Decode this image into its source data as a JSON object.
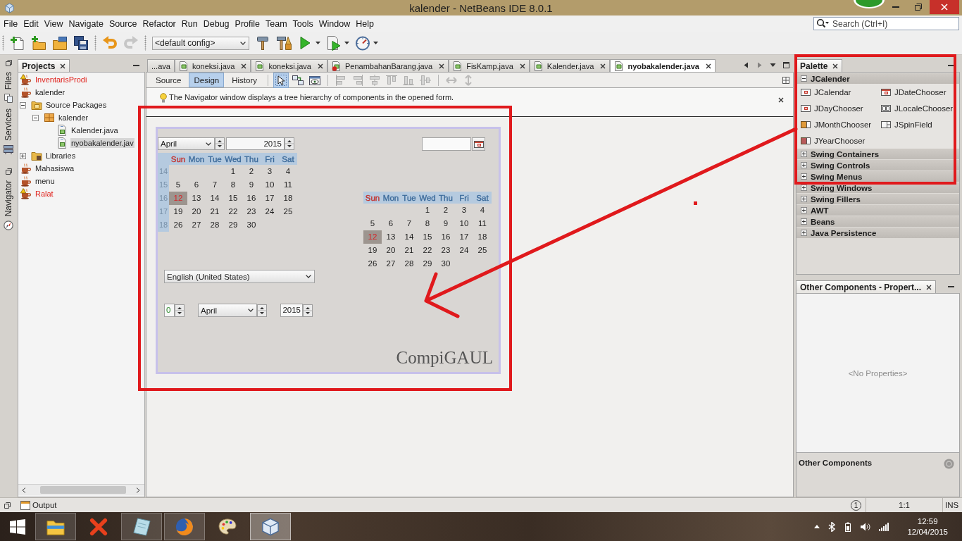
{
  "window": {
    "title": "kalender - NetBeans IDE 8.0.1"
  },
  "menu": [
    "File",
    "Edit",
    "View",
    "Navigate",
    "Source",
    "Refactor",
    "Run",
    "Debug",
    "Profile",
    "Team",
    "Tools",
    "Window",
    "Help"
  ],
  "search": {
    "placeholder": "Search (Ctrl+I)"
  },
  "toolbar": [
    {
      "kind": "separator"
    },
    {
      "kind": "new-file",
      "disabled": false
    },
    {
      "kind": "new-project",
      "disabled": false
    },
    {
      "kind": "open-project",
      "disabled": false
    },
    {
      "kind": "save-all",
      "disabled": false
    },
    {
      "kind": "separator"
    },
    {
      "kind": "undo",
      "disabled": false
    },
    {
      "kind": "redo",
      "disabled": true
    },
    {
      "kind": "separator"
    },
    {
      "kind": "config",
      "value": "<default config>"
    },
    {
      "kind": "build",
      "disabled": false
    },
    {
      "kind": "clean-build",
      "disabled": false
    },
    {
      "kind": "run",
      "disabled": false
    },
    {
      "kind": "debug",
      "disabled": false
    },
    {
      "kind": "profile",
      "disabled": false
    }
  ],
  "side_panels": [
    {
      "tabs": [
        {
          "label": "Files",
          "kind": "files"
        },
        {
          "label": "Services",
          "kind": "services"
        }
      ]
    },
    {
      "tabs": [
        {
          "label": "Navigator",
          "kind": "navigator"
        }
      ]
    }
  ],
  "projects": {
    "title": "Projects",
    "tree": [
      {
        "label": "InventarisProdi",
        "kind": "project",
        "error": true,
        "selected": false
      },
      {
        "label": "kalender",
        "kind": "project",
        "error": false,
        "selected": false,
        "children": [
          {
            "label": "Source Packages",
            "kind": "sources",
            "expanded": true,
            "selected": false,
            "children": [
              {
                "label": "kalender",
                "kind": "package",
                "expanded": true,
                "selected": false,
                "children": [
                  {
                    "label": "Kalender.java",
                    "kind": "form",
                    "selected": false
                  },
                  {
                    "label": "nyobakalender.jav",
                    "kind": "form",
                    "selected": true
                  }
                ]
              }
            ]
          },
          {
            "label": "Libraries",
            "kind": "libraries",
            "expanded": false,
            "selected": false
          }
        ]
      },
      {
        "label": "Mahasiswa",
        "kind": "project",
        "error": false,
        "selected": false
      },
      {
        "label": "menu",
        "kind": "project",
        "error": false,
        "selected": false
      },
      {
        "label": "Ralat",
        "kind": "project",
        "error": true,
        "selected": false
      }
    ]
  },
  "editor": {
    "tabs": [
      {
        "label": "...ava",
        "kind": "clipped",
        "selected": false
      },
      {
        "label": "koneksi.java",
        "kind": "file",
        "error": false,
        "selected": false
      },
      {
        "label": "koneksi.java",
        "kind": "file",
        "error": false,
        "selected": false
      },
      {
        "label": "PenambahanBarang.java",
        "kind": "file",
        "error": true,
        "selected": false
      },
      {
        "label": "FisKamp.java",
        "kind": "file",
        "error": false,
        "selected": false
      },
      {
        "label": "Kalender.java",
        "kind": "file",
        "error": false,
        "selected": false
      },
      {
        "label": "nyobakalender.java",
        "kind": "file",
        "error": false,
        "selected": true
      }
    ],
    "tab_nav": [
      {
        "kind": "previous",
        "disabled": false
      },
      {
        "kind": "next",
        "disabled": true
      },
      {
        "kind": "list",
        "disabled": false
      },
      {
        "kind": "maximize",
        "disabled": false
      }
    ],
    "views": [
      {
        "label": "Source",
        "selected": false
      },
      {
        "label": "Design",
        "selected": true
      },
      {
        "label": "History",
        "selected": false
      }
    ],
    "design_tools": [
      {
        "kind": "selection",
        "selected": true
      },
      {
        "kind": "connection",
        "selected": false
      },
      {
        "kind": "preview",
        "selected": false
      },
      {
        "kind": "separator"
      },
      {
        "kind": "align-left",
        "disabled": true
      },
      {
        "kind": "align-right",
        "disabled": true
      },
      {
        "kind": "align-center",
        "disabled": true
      },
      {
        "kind": "align-top",
        "disabled": true
      },
      {
        "kind": "align-bottom",
        "disabled": true
      },
      {
        "kind": "align-middle",
        "disabled": true
      },
      {
        "kind": "separator"
      },
      {
        "kind": "resize-horizontal",
        "disabled": true
      },
      {
        "kind": "resize-vertical",
        "disabled": true
      }
    ],
    "hint": "The Navigator window displays a tree hierarchy of components in the opened form.",
    "form": {
      "calendar": {
        "month": "April",
        "year": "2015",
        "weekdays": [
          {
            "label": "Sun",
            "color": "#c4302b"
          },
          {
            "label": "Mon",
            "color": "#3b6a9a"
          },
          {
            "label": "Tue",
            "color": "#3b6a9a"
          },
          {
            "label": "Wed",
            "color": "#3b6a9a"
          },
          {
            "label": "Thu",
            "color": "#3b6a9a"
          },
          {
            "label": "Fri",
            "color": "#3b6a9a"
          },
          {
            "label": "Sat",
            "color": "#3b6a9a"
          }
        ],
        "weeks": [
          {
            "number": "14",
            "days": [
              {
                "label": "1",
                "selected": false
              },
              {
                "label": "2",
                "selected": false
              },
              {
                "label": "3",
                "selected": false
              },
              {
                "label": "4",
                "selected": false
              }
            ]
          },
          {
            "number": "15",
            "days": [
              {
                "label": "5",
                "selected": false
              },
              {
                "label": "6",
                "selected": false
              },
              {
                "label": "7",
                "selected": false
              },
              {
                "label": "8",
                "selected": false
              },
              {
                "label": "9",
                "selected": false
              },
              {
                "label": "10",
                "selected": false
              },
              {
                "label": "11",
                "selected": false
              }
            ]
          },
          {
            "number": "16",
            "days": [
              {
                "label": "12",
                "selected": true
              },
              {
                "label": "13",
                "selected": false
              },
              {
                "label": "14",
                "selected": false
              },
              {
                "label": "15",
                "selected": false
              },
              {
                "label": "16",
                "selected": false
              },
              {
                "label": "17",
                "selected": false
              },
              {
                "label": "18",
                "selected": false
              }
            ]
          },
          {
            "number": "17",
            "days": [
              {
                "label": "19",
                "selected": false
              },
              {
                "label": "20",
                "selected": false
              },
              {
                "label": "21",
                "selected": false
              },
              {
                "label": "22",
                "selected": false
              },
              {
                "label": "23",
                "selected": false
              },
              {
                "label": "24",
                "selected": false
              },
              {
                "label": "25",
                "selected": false
              }
            ]
          },
          {
            "number": "18",
            "days": [
              {
                "label": "26",
                "selected": false
              },
              {
                "label": "27",
                "selected": false
              },
              {
                "label": "28",
                "selected": false
              },
              {
                "label": "29",
                "selected": false
              },
              {
                "label": "30",
                "selected": false
              }
            ]
          }
        ]
      },
      "day_chooser": {
        "weekdays": [
          {
            "label": "Sun",
            "color": "#c4302b"
          },
          {
            "label": "Mon",
            "color": "#3b6a9a"
          },
          {
            "label": "Tue",
            "color": "#3b6a9a"
          },
          {
            "label": "Wed",
            "color": "#3b6a9a"
          },
          {
            "label": "Thu",
            "color": "#3b6a9a"
          },
          {
            "label": "Fri",
            "color": "#3b6a9a"
          },
          {
            "label": "Sat",
            "color": "#3b6a9a"
          }
        ],
        "weeks": [
          {
            "days": [
              {
                "label": "1",
                "selected": false
              },
              {
                "label": "2",
                "selected": false
              },
              {
                "label": "3",
                "selected": false
              },
              {
                "label": "4",
                "selected": false
              }
            ]
          },
          {
            "days": [
              {
                "label": "5",
                "selected": false
              },
              {
                "label": "6",
                "selected": false
              },
              {
                "label": "7",
                "selected": false
              },
              {
                "label": "8",
                "selected": false
              },
              {
                "label": "9",
                "selected": false
              },
              {
                "label": "10",
                "selected": false
              },
              {
                "label": "11",
                "selected": false
              }
            ]
          },
          {
            "days": [
              {
                "label": "12",
                "selected": true
              },
              {
                "label": "13",
                "selected": false
              },
              {
                "label": "14",
                "selected": false
              },
              {
                "label": "15",
                "selected": false
              },
              {
                "label": "16",
                "selected": false
              },
              {
                "label": "17",
                "selected": false
              },
              {
                "label": "18",
                "selected": false
              }
            ]
          },
          {
            "days": [
              {
                "label": "19",
                "selected": false
              },
              {
                "label": "20",
                "selected": false
              },
              {
                "label": "21",
                "selected": false
              },
              {
                "label": "22",
                "selected": false
              },
              {
                "label": "23",
                "selected": false
              },
              {
                "label": "24",
                "selected": false
              },
              {
                "label": "25",
                "selected": false
              }
            ]
          },
          {
            "days": [
              {
                "label": "26",
                "selected": false
              },
              {
                "label": "27",
                "selected": false
              },
              {
                "label": "28",
                "selected": false
              },
              {
                "label": "29",
                "selected": false
              },
              {
                "label": "30",
                "selected": false
              }
            ]
          }
        ]
      },
      "locale_chooser": "English (United States)",
      "spin_field": {
        "value": "0",
        "valid": true
      },
      "month_chooser": "April",
      "year_chooser": "2015",
      "label": "CompiGAUL"
    }
  },
  "palette": {
    "title": "Palette",
    "categories": [
      {
        "label": "JCalender",
        "expanded": true,
        "items": [
          {
            "label": "JCalendar",
            "kind": "calendar"
          },
          {
            "label": "JDateChooser",
            "kind": "date"
          },
          {
            "label": "JDayChooser",
            "kind": "calendar"
          },
          {
            "label": "JLocaleChooser",
            "kind": "combo"
          },
          {
            "label": "JMonthChooser",
            "kind": "month"
          },
          {
            "label": "JSpinField",
            "kind": "spinner"
          },
          {
            "label": "JYearChooser",
            "kind": "year"
          }
        ]
      },
      {
        "label": "Swing Containers",
        "expanded": false
      },
      {
        "label": "Swing Controls",
        "expanded": false
      },
      {
        "label": "Swing Menus",
        "expanded": false
      },
      {
        "label": "Swing Windows",
        "expanded": false
      },
      {
        "label": "Swing Fillers",
        "expanded": false
      },
      {
        "label": "AWT",
        "expanded": false
      },
      {
        "label": "Beans",
        "expanded": false
      },
      {
        "label": "Java Persistence",
        "expanded": false
      }
    ]
  },
  "properties": {
    "title": "Other Components - Propert...",
    "empty": "<No Properties>",
    "footer": "Other Components"
  },
  "status_bar": {
    "output": "Output",
    "notifications": "1",
    "position": "1:1",
    "mode": "INS"
  },
  "taskbar": {
    "apps": [
      {
        "kind": "explorer",
        "running": true,
        "selected": false
      },
      {
        "kind": "tool",
        "running": false,
        "selected": false
      },
      {
        "kind": "notepad",
        "running": true,
        "selected": false
      },
      {
        "kind": "browser",
        "running": true,
        "selected": false
      },
      {
        "kind": "paint",
        "running": false,
        "selected": false
      },
      {
        "kind": "ide",
        "running": true,
        "selected": true
      }
    ],
    "time": "12:59",
    "date": "12/04/2015"
  }
}
